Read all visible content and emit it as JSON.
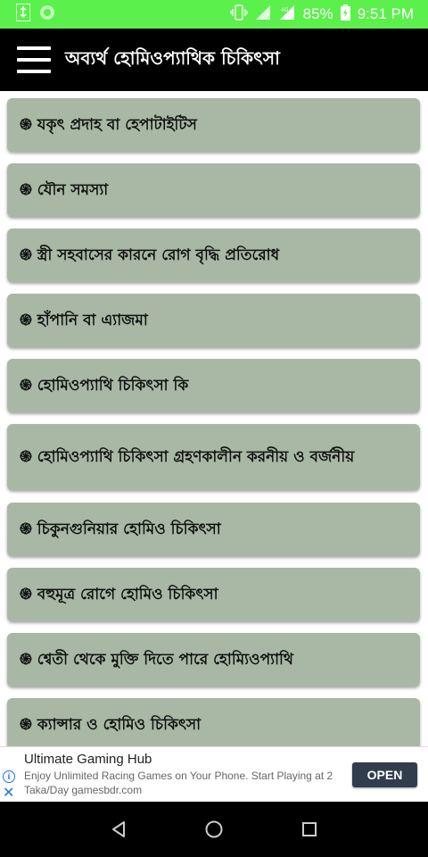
{
  "status_bar": {
    "battery": "85%",
    "time": "9:51 PM",
    "icons": [
      "usb-icon",
      "sync-icon",
      "vibrate-icon",
      "signal-icon",
      "4g-signal-icon",
      "battery-charging-icon"
    ]
  },
  "app_bar": {
    "title": "অব্যর্থ হোমিওপ্যাথিক চিকিৎসা",
    "menu_icon": "hamburger-menu-icon"
  },
  "list": {
    "items": [
      {
        "label": "֍ যকৃৎ প্রদাহ বা হেপাটাইটিস"
      },
      {
        "label": "֍ যৌন সমস্যা"
      },
      {
        "label": "֍ স্ত্রী সহবাসের কারনে রোগ বৃদ্ধি প্রতিরোধ"
      },
      {
        "label": "֍ হাঁপানি বা এ্যাজমা"
      },
      {
        "label": "֍ হোমিওপ্যাথি চিকিৎসা কি"
      },
      {
        "label": "֍ হোমিওপ্যাথি চিকিৎসা গ্রহণকালীন করনীয় ও বর্জনীয়"
      },
      {
        "label": "֍ চিকুনগুনিয়ার হোমিও চিকিৎসা"
      },
      {
        "label": "֍ বহুমূত্র রোগে হোমিও চিকিৎসা"
      },
      {
        "label": "֍ শ্বেতী থেকে মুক্তি দিতে পারে হোম্যিওপ্যাথি"
      },
      {
        "label": "֍ ক্যান্সার ও হোমিও চিকিৎসা"
      }
    ]
  },
  "ad": {
    "title": "Ultimate Gaming Hub",
    "description": "Enjoy Unlimited Racing Games on Your Phone. Start Playing at 2 Taka/Day gamesbdr.com",
    "button": "OPEN",
    "info_glyph": "i",
    "close_glyph": "✕"
  },
  "nav_bar": {
    "buttons": [
      "back-icon",
      "home-icon",
      "recents-icon"
    ]
  },
  "colors": {
    "status_bar": "#5cf04c",
    "app_bar": "#000000",
    "card": "#a9b8a5",
    "ad_button": "#313d4d"
  }
}
